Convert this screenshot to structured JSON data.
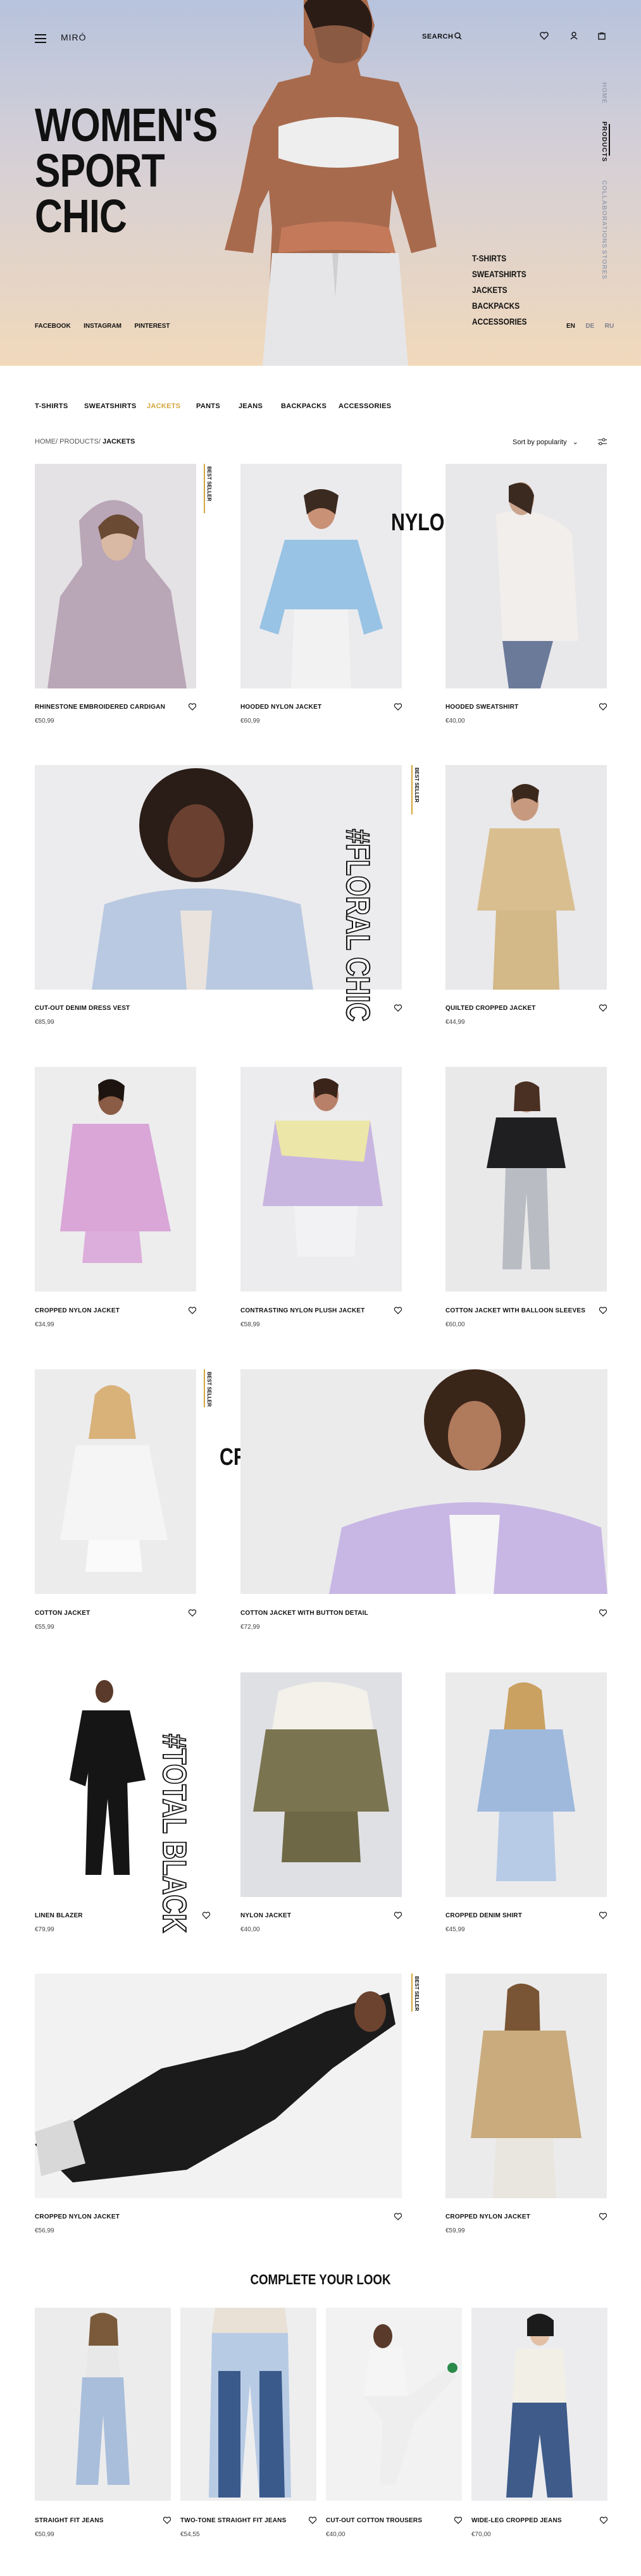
{
  "header": {
    "logo": "MIRÓ",
    "search_label": "SEARCH",
    "icons": [
      "menu-icon",
      "search-icon",
      "heart-icon",
      "user-icon",
      "bag-icon"
    ]
  },
  "hero": {
    "title_lines": [
      "WOMEN'S",
      "SPORT",
      "CHIC"
    ],
    "socials": [
      "FACEBOOK",
      "INSTAGRAM",
      "PINTEREST"
    ],
    "categories": [
      "T-SHIRTS",
      "SWEATSHIRTS",
      "JACKETS",
      "BACKPACKS",
      "ACCESSORIES"
    ],
    "side_nav": [
      "HOME",
      "PRODUCTS",
      "COLLABORATIONS",
      "STORES"
    ],
    "side_nav_active": "PRODUCTS",
    "languages": [
      "EN",
      "DE",
      "RU"
    ],
    "language_active": "EN"
  },
  "filters": {
    "tabs": [
      "T-SHIRTS",
      "SWEATSHIRTS",
      "JACKETS",
      "PANTS",
      "JEANS",
      "BACKPACKS",
      "ACCESSORIES"
    ],
    "active_tab": "JACKETS",
    "breadcrumb_root": "HOME/ PRODUCTS/",
    "breadcrumb_current": "JACKETS",
    "sort_label": "Sort by popularity"
  },
  "badges": {
    "best_seller": "BEST SELLER"
  },
  "promo_words": {
    "nylon": "NYLON",
    "floral": "#FLORAL CHIC",
    "cropped": "CROPPED",
    "total_black": "#TOTAL BLACK"
  },
  "products": [
    {
      "name": "RHINESTONE EMBROIDERED CARDIGAN",
      "price": "€50,99"
    },
    {
      "name": "HOODED NYLON JACKET",
      "price": "€60,99"
    },
    {
      "name": "HOODED SWEATSHIRT",
      "price": "€40,00"
    },
    {
      "name": "CUT-OUT DENIM DRESS VEST",
      "price": "€85,99"
    },
    {
      "name": "QUILTED CROPPED JACKET",
      "price": "€44,99"
    },
    {
      "name": "CROPPED NYLON JACKET",
      "price": "€34,99"
    },
    {
      "name": "CONTRASTING NYLON PLUSH JACKET",
      "price": "€58,99"
    },
    {
      "name": "COTTON JACKET WITH BALLOON SLEEVES",
      "price": "€60,00"
    },
    {
      "name": "COTTON JACKET",
      "price": "€55,99"
    },
    {
      "name": "COTTON JACKET WITH BUTTON DETAIL",
      "price": "€72,99"
    },
    {
      "name": "LINEN BLAZER",
      "price": "€79,99"
    },
    {
      "name": "NYLON JACKET",
      "price": "€40,00"
    },
    {
      "name": "CROPPED DENIM SHIRT",
      "price": "€45,99"
    },
    {
      "name": "CROPPED NYLON JACKET",
      "price": "€56,99"
    },
    {
      "name": "CROPPED NYLON JACKET",
      "price": "€59,99"
    }
  ],
  "complete_look": {
    "title": "COMPLETE YOUR LOOK",
    "items": [
      {
        "name": "STRAIGHT FIT JEANS",
        "price": "€50,99"
      },
      {
        "name": "TWO-TONE STRAIGHT FIT JEANS",
        "price": "€54,55"
      },
      {
        "name": "CUT-OUT COTTON TROUSERS",
        "price": "€40,00"
      },
      {
        "name": "WIDE-LEG CROPPED JEANS",
        "price": "€70,00"
      }
    ]
  },
  "colors": {
    "accent": "#d4a63a",
    "text": "#111111",
    "hero_top": "#b7c3dd",
    "hero_bottom": "#f1d9bb"
  }
}
